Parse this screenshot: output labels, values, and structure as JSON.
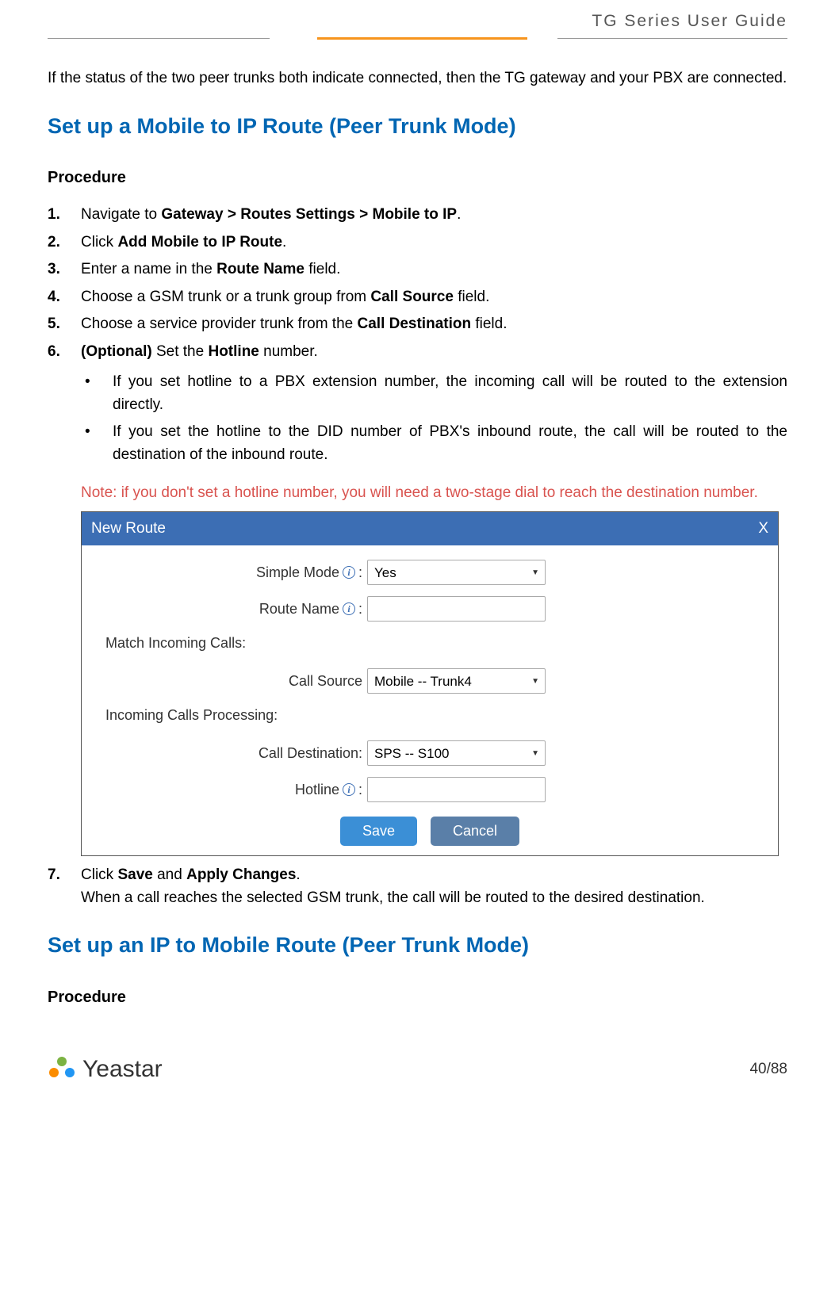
{
  "header": {
    "title": "TG  Series  User  Guide"
  },
  "intro_para": "If the status of the two peer trunks both indicate connected, then the TG gateway and your PBX are connected.",
  "section1": {
    "title": "Set up a Mobile to IP Route (Peer Trunk Mode)",
    "subtitle": "Procedure"
  },
  "steps": [
    {
      "num": "1.",
      "prefix": "Navigate to ",
      "bold": "Gateway > Routes Settings > Mobile to IP",
      "suffix": "."
    },
    {
      "num": "2.",
      "prefix": "Click ",
      "bold": "Add Mobile to IP Route",
      "suffix": "."
    },
    {
      "num": "3.",
      "prefix": "Enter a name in the ",
      "bold": "Route Name",
      "suffix": " field."
    },
    {
      "num": "4.",
      "prefix": "Choose a GSM trunk or a trunk group from ",
      "bold": "Call Source",
      "suffix": " field."
    },
    {
      "num": "5.",
      "prefix": "Choose a service provider trunk from the ",
      "bold": "Call Destination",
      "suffix": " field."
    },
    {
      "num": "6.",
      "bold_prefix": "(Optional) ",
      "prefix": "Set the ",
      "bold": "Hotline",
      "suffix": " number."
    }
  ],
  "bullets": [
    "If you set hotline to a PBX extension number, the incoming call will be routed to the extension directly.",
    "If you set the hotline to the DID number of PBX's inbound route, the call will be routed to the destination of the inbound route."
  ],
  "note": "Note: if you don't set a hotline number, you will need a two-stage dial to reach the destination number.",
  "dialog": {
    "title": "New Route",
    "close": "X",
    "simple_mode_label": "Simple Mode",
    "simple_mode_value": "Yes",
    "route_name_label": "Route Name",
    "match_label": "Match Incoming Calls:",
    "call_source_label": "Call Source",
    "call_source_value": "Mobile -- Trunk4",
    "processing_label": "Incoming Calls Processing:",
    "call_dest_label": "Call Destination:",
    "call_dest_value": "SPS -- S100",
    "hotline_label": "Hotline",
    "save": "Save",
    "cancel": "Cancel"
  },
  "step7": {
    "num": "7.",
    "prefix": "Click ",
    "bold1": "Save",
    "mid": " and ",
    "bold2": "Apply Changes",
    "suffix": ".",
    "line2": "When a call reaches the selected GSM trunk, the call will be routed to the desired destination."
  },
  "section2": {
    "title": "Set up an IP to Mobile Route (Peer Trunk Mode)",
    "subtitle": "Procedure"
  },
  "footer": {
    "logo_text": "Yeastar",
    "page": "40/88"
  }
}
